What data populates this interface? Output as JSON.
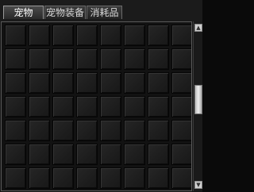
{
  "tabs": [
    {
      "label": "宠物",
      "active": true
    },
    {
      "label": "宠物装备",
      "active": false
    },
    {
      "label": "消耗品",
      "active": false
    }
  ],
  "grid": {
    "columns": 8,
    "rows": 7
  },
  "scrollbar": {
    "up_icon": "arrow-up-icon",
    "down_icon": "arrow-down-icon",
    "up_glyph": "▲",
    "down_glyph": "▼"
  }
}
